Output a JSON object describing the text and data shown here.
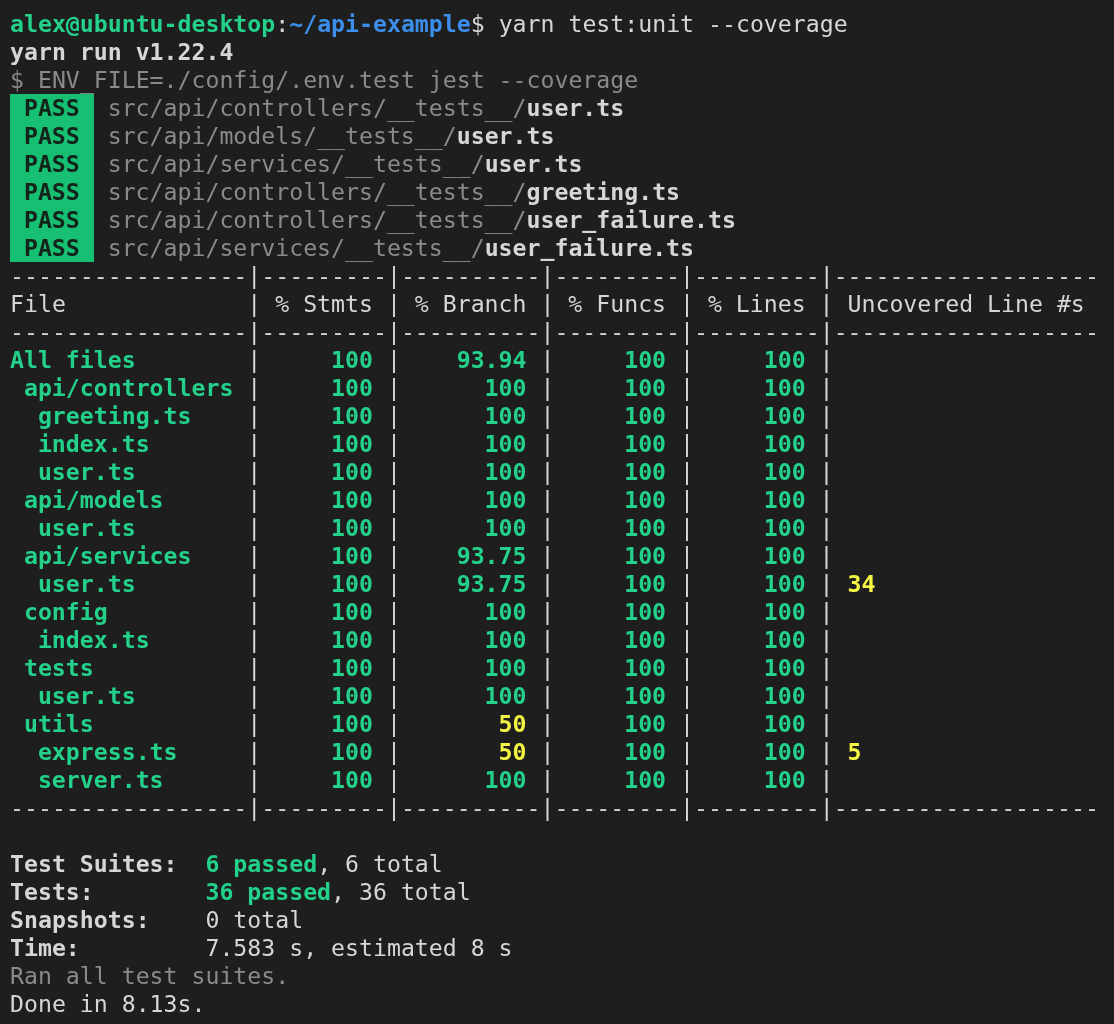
{
  "prompt": {
    "user_host": "alex@ubuntu-desktop",
    "separator": ":",
    "path": "~/api-example",
    "symbol": "$",
    "command": "yarn test:unit --coverage"
  },
  "yarn_line": "yarn run v1.22.4",
  "script_line": "$ ENV_FILE=./config/.env.test jest --coverage",
  "results": [
    {
      "status": "PASS",
      "dir": "src/api/controllers/__tests__/",
      "file": "user.ts"
    },
    {
      "status": "PASS",
      "dir": "src/api/models/__tests__/",
      "file": "user.ts"
    },
    {
      "status": "PASS",
      "dir": "src/api/services/__tests__/",
      "file": "user.ts"
    },
    {
      "status": "PASS",
      "dir": "src/api/controllers/__tests__/",
      "file": "greeting.ts"
    },
    {
      "status": "PASS",
      "dir": "src/api/controllers/__tests__/",
      "file": "user_failure.ts"
    },
    {
      "status": "PASS",
      "dir": "src/api/services/__tests__/",
      "file": "user_failure.ts"
    }
  ],
  "table": {
    "rule_top": "-----------------|---------|----------|---------|---------|-------------------",
    "rule_mid": "-----------------|---------|----------|---------|---------|-------------------",
    "rule_bottom": "-----------------|---------|----------|---------|---------|-------------------",
    "divider": "|",
    "columns": [
      "File",
      "% Stmts",
      "% Branch",
      "% Funcs",
      "% Lines",
      "Uncovered Line #s"
    ],
    "rows": [
      {
        "cells": [
          "All files",
          "100",
          "93.94",
          "100",
          "100"
        ],
        "low_branch": false,
        "children": [
          {
            "cells": [
              "api/controllers",
              "100",
              "100",
              "100",
              "100"
            ],
            "low_branch": false,
            "children": [
              {
                "cells": [
                  "greeting.ts",
                  "100",
                  "100",
                  "100",
                  "100"
                ],
                "low_branch": false
              },
              {
                "cells": [
                  "index.ts",
                  "100",
                  "100",
                  "100",
                  "100"
                ],
                "low_branch": false
              },
              {
                "cells": [
                  "user.ts",
                  "100",
                  "100",
                  "100",
                  "100"
                ],
                "low_branch": false
              }
            ]
          },
          {
            "cells": [
              "api/models",
              "100",
              "100",
              "100",
              "100"
            ],
            "low_branch": false,
            "children": [
              {
                "cells": [
                  "user.ts",
                  "100",
                  "100",
                  "100",
                  "100"
                ],
                "low_branch": false
              }
            ]
          },
          {
            "cells": [
              "api/services",
              "100",
              "93.75",
              "100",
              "100"
            ],
            "low_branch": false,
            "children": [
              {
                "cells": [
                  "user.ts",
                  "100",
                  "93.75",
                  "100",
                  "100",
                  "34"
                ],
                "low_branch": false
              }
            ]
          },
          {
            "cells": [
              "config",
              "100",
              "100",
              "100",
              "100"
            ],
            "low_branch": false,
            "children": [
              {
                "cells": [
                  "index.ts",
                  "100",
                  "100",
                  "100",
                  "100"
                ],
                "low_branch": false
              }
            ]
          },
          {
            "cells": [
              "tests",
              "100",
              "100",
              "100",
              "100"
            ],
            "low_branch": false,
            "children": [
              {
                "cells": [
                  "user.ts",
                  "100",
                  "100",
                  "100",
                  "100"
                ],
                "low_branch": false
              }
            ]
          },
          {
            "cells": [
              "utils",
              "100",
              "50",
              "100",
              "100"
            ],
            "low_branch": true,
            "children": [
              {
                "cells": [
                  "express.ts",
                  "100",
                  "50",
                  "100",
                  "100",
                  "5"
                ],
                "low_branch": true
              },
              {
                "cells": [
                  "server.ts",
                  "100",
                  "100",
                  "100",
                  "100"
                ],
                "low_branch": false
              }
            ]
          }
        ]
      }
    ]
  },
  "summary": [
    {
      "label": "Test Suites:",
      "passed": "6 passed",
      "rest": ", 6 total"
    },
    {
      "label": "Tests:",
      "passed": "36 passed",
      "rest": ", 36 total"
    },
    {
      "label": "Snapshots:",
      "rest": "0 total"
    },
    {
      "label": "Time:",
      "rest": "7.583 s, estimated 8 s"
    }
  ],
  "ran_line": "Ran all test suites.",
  "done_line": "Done in 8.13s."
}
